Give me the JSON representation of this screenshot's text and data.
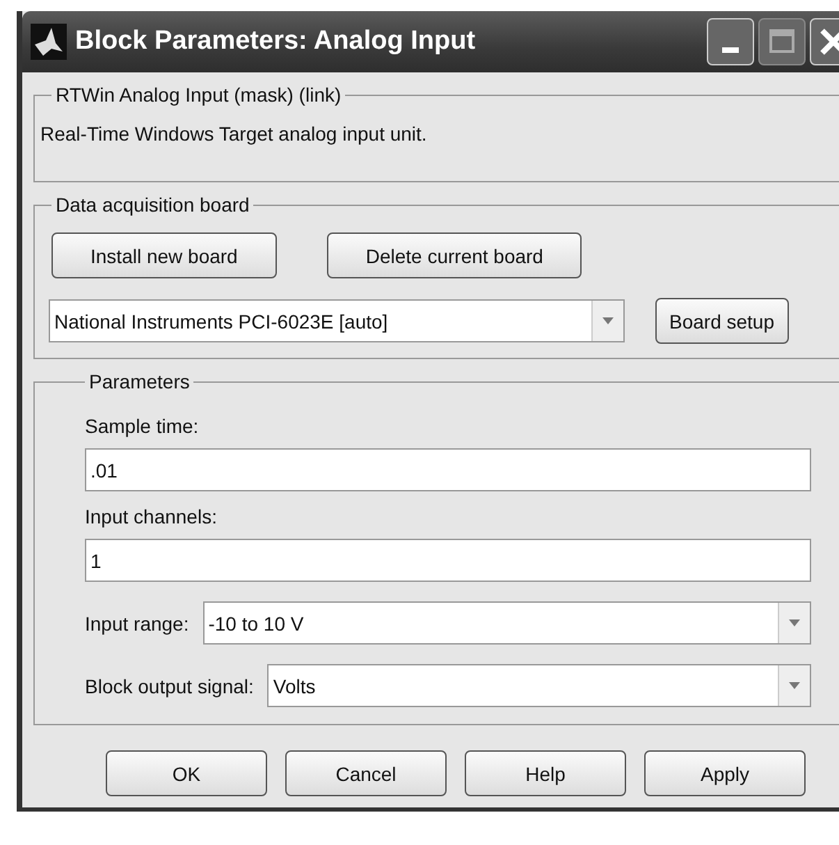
{
  "window": {
    "title": "Block Parameters: Analog Input"
  },
  "mask_group": {
    "title": "RTWin Analog Input (mask) (link)",
    "description": "Real-Time Windows Target analog input unit."
  },
  "board_group": {
    "title": "Data acquisition board",
    "buttons": [
      "Install new board",
      "Delete current board"
    ],
    "board": {
      "value": "National Instruments PCI-6023E [auto]"
    },
    "setup_button": "Board setup"
  },
  "parameters": {
    "title": "Parameters",
    "fields": [
      {
        "kind": "text",
        "label": "Sample time:",
        "value": ".01"
      },
      {
        "kind": "text",
        "label": "Input channels:",
        "value": "1"
      },
      {
        "kind": "select",
        "label": "Input range:",
        "value": "-10 to 10 V"
      },
      {
        "kind": "select",
        "label": "Block output signal:",
        "value": "Volts"
      }
    ]
  },
  "buttons": [
    "OK",
    "Cancel",
    "Help",
    "Apply"
  ]
}
